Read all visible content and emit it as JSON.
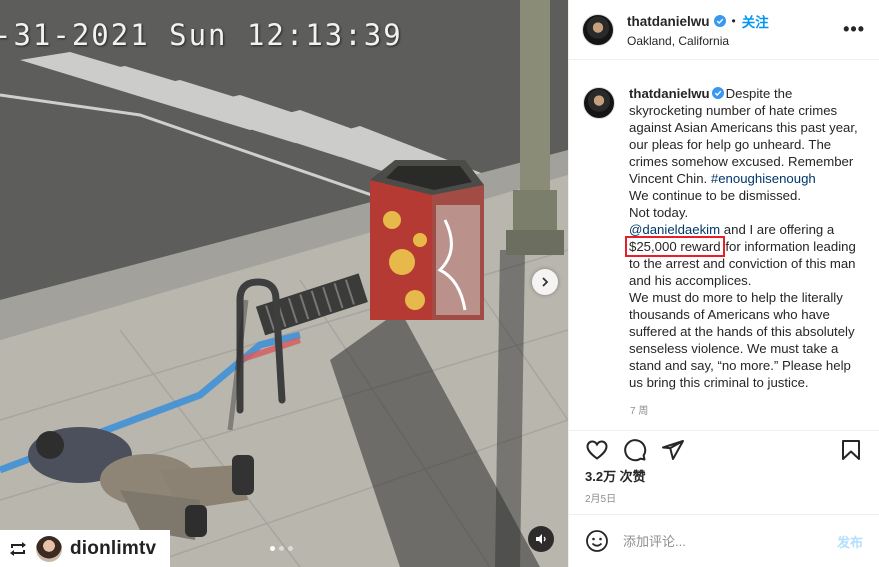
{
  "media": {
    "timestamp": "-31-2021 Sun 12:13:39",
    "repost": {
      "icon": "repost-icon",
      "username": "dionlimtv"
    },
    "carousel": {
      "count": 3,
      "active": 1
    }
  },
  "header": {
    "username": "thatdanielwu",
    "separator": "•",
    "follow_label": "关注",
    "location": "Oakland, California",
    "more_label": "•••"
  },
  "caption": {
    "username": "thatdanielwu",
    "lines": [
      "Despite the",
      "skyrocketing number of hate crimes",
      "against Asian Americans this past year,",
      "our pleas for help go unheard. The",
      "crimes somehow excused. Remember"
    ],
    "vc_text": "Vincent Chin.",
    "hashtag": "#enoughisenough",
    "line_dismissed": "We continue to be dismissed.",
    "line_today": "Not today.",
    "mention": "@danieldaekim",
    "mention_rest": " and I are offering a",
    "reward": "$25,000 reward",
    "reward_rest": " for information leading",
    "tail_lines": [
      "to the arrest and conviction of this man",
      "and his accomplices.",
      "We must do more to help the literally",
      "thousands of Americans who have",
      "suffered at the hands of this absolutely",
      "senseless violence. We must take a",
      "stand and say, “no more.” Please help",
      "us bring this criminal to justice."
    ],
    "time_ago": "7 周"
  },
  "likes": "3.2万 次赞",
  "date": "2月5日",
  "comment": {
    "placeholder": "添加评论...",
    "post_label": "发布"
  },
  "colors": {
    "link": "#00376b",
    "follow": "#0095f6",
    "highlight": "#e5202a"
  }
}
